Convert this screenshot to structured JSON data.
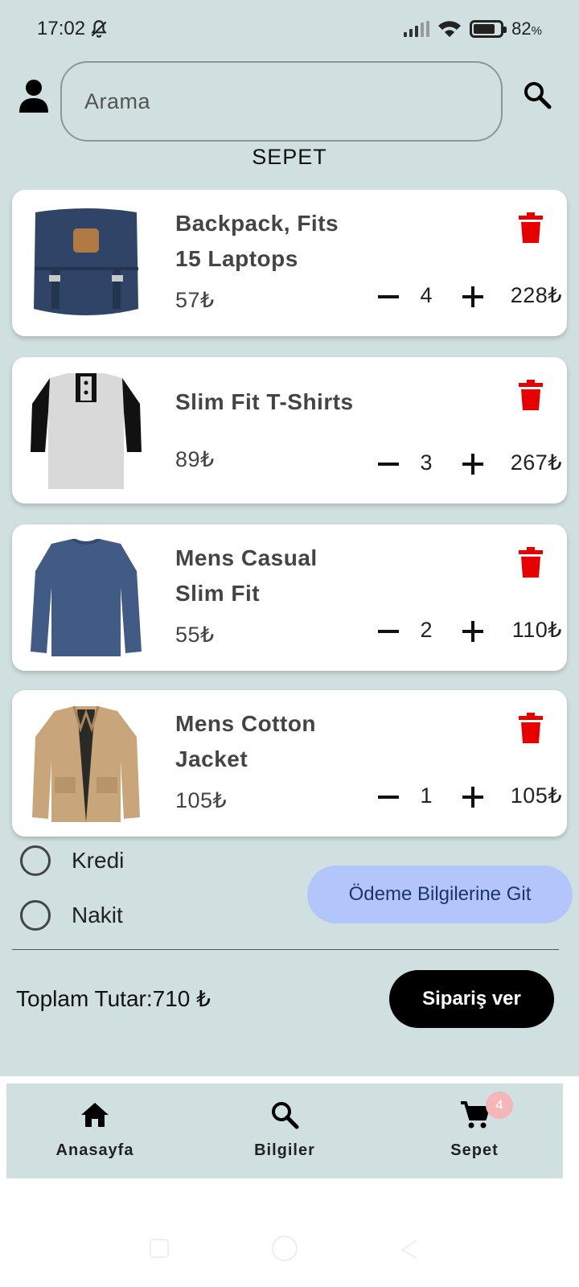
{
  "status_bar": {
    "time": "17:02",
    "battery_percent": "82",
    "battery_unit": "%"
  },
  "header": {
    "search_placeholder": "Arama",
    "page_title": "SEPET"
  },
  "cart": {
    "items": [
      {
        "name": "Backpack, Fits 15 Laptops",
        "price": "57₺",
        "quantity": "4",
        "line_total": "228₺",
        "image": "backpack"
      },
      {
        "name": "Slim Fit T-Shirts",
        "price": "89₺",
        "quantity": "3",
        "line_total": "267₺",
        "image": "tshirt"
      },
      {
        "name": "Mens Casual Slim Fit",
        "price": "55₺",
        "quantity": "2",
        "line_total": "110₺",
        "image": "longsleeve"
      },
      {
        "name": "Mens Cotton Jacket",
        "price": "105₺",
        "quantity": "1",
        "line_total": "105₺",
        "image": "jacket"
      }
    ]
  },
  "payment": {
    "option_credit": "Kredi",
    "option_cash": "Nakit",
    "info_button": "Ödeme Bilgilerine Git",
    "total_label": "Toplam Tutar:710 ₺",
    "order_button": "Sipariş ver"
  },
  "bottom_nav": {
    "home_label": "Anasayfa",
    "info_label": "Bilgiler",
    "cart_label": "Sepet",
    "cart_badge": "4"
  },
  "colors": {
    "background": "#d0dfdf",
    "delete_icon": "#e60000",
    "info_button_bg": "#b2c6fb",
    "order_button_bg": "#000000",
    "badge_bg": "#f4b6b6"
  }
}
